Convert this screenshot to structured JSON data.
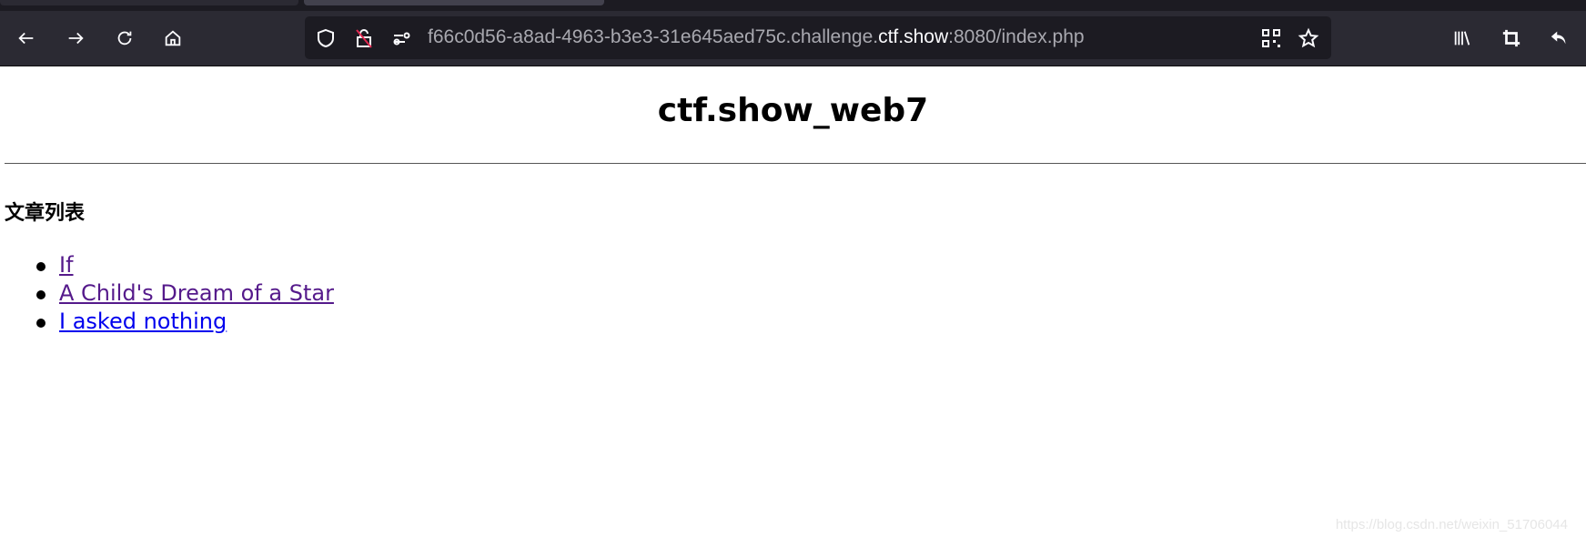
{
  "browser": {
    "url_prefix": "f66c0d56-a8ad-4963-b3e3-31e645aed75c.challenge.",
    "url_host": "ctf.show",
    "url_suffix": ":8080/index.php",
    "icons": {
      "back": "arrow-left-icon",
      "forward": "arrow-right-icon",
      "reload": "reload-icon",
      "home": "home-icon",
      "shield": "shield-icon",
      "lock": "insecure-lock-icon",
      "permissions": "permissions-icon",
      "qr": "qr-code-icon",
      "bookmark": "star-icon",
      "library": "library-icon",
      "crop": "crop-icon",
      "undo": "undo-icon"
    }
  },
  "page": {
    "title": "ctf.show_web7",
    "section_heading": "文章列表",
    "articles": [
      {
        "label": "If",
        "visited": true
      },
      {
        "label": "A Child's Dream of a Star",
        "visited": true
      },
      {
        "label": "I asked nothing",
        "visited": false
      }
    ]
  },
  "watermark": "https://blog.csdn.net/weixin_51706044"
}
